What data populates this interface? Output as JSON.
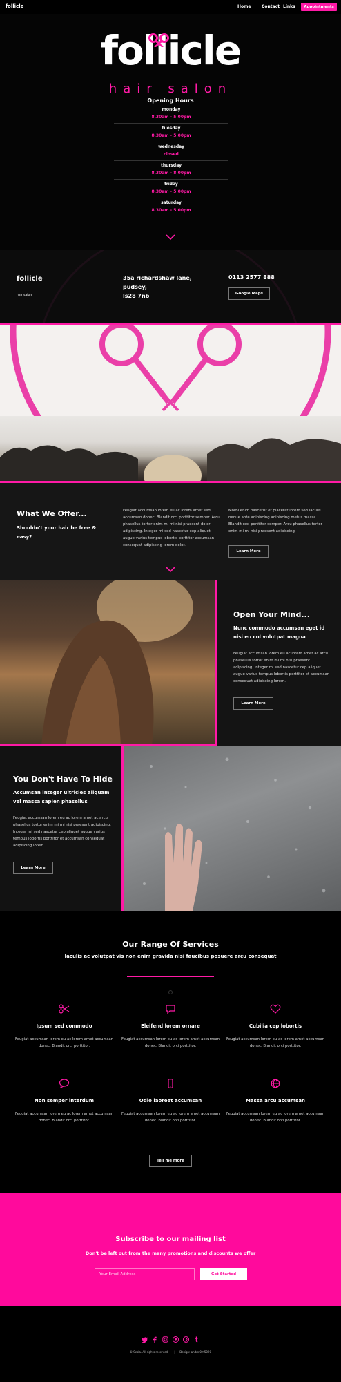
{
  "nav": {
    "brand": "follicle",
    "links": [
      "Home",
      "Contact",
      "Links"
    ],
    "cta": "Appointments"
  },
  "hero": {
    "logo": "follicle",
    "tagline": "hair salon",
    "hours_title": "Opening Hours",
    "days": [
      {
        "day": "monday",
        "time": "8.30am - 5.00pm"
      },
      {
        "day": "tuesday",
        "time": "8.30am - 5.00pm"
      },
      {
        "day": "wednesday",
        "time": "closed"
      },
      {
        "day": "thursday",
        "time": "8.30am - 8.00pm"
      },
      {
        "day": "friday",
        "time": "8.30am - 5.00pm"
      },
      {
        "day": "saturday",
        "time": "8.30am - 5.00pm"
      }
    ]
  },
  "contact": {
    "name": "follicle",
    "sub": "hair salon",
    "address_1": "35a richardshaw lane,",
    "address_2": "pudsey,",
    "address_3": "ls28 7nb",
    "phone": "0113 2577 888",
    "maps_button": "Google Maps"
  },
  "offer": {
    "heading": "What We Offer...",
    "question": "Shouldn't your hair be free & easy?",
    "text_1": "Feugiat accumsan lorem eu ac lorem amet sed accumsan donec. Blandit orci porttitor semper. Arcu phasellus tortor enim mi mi nisi praesent dolor adipiscing. Integer mi sed nascetur cep aliquet augue varius tempus lobortis porttitor accumsan consequat adipiscing lorem dolor.",
    "text_2": "Morbi enim nascetur et placerat lorem sed iaculis neque ante adipiscing adipiscing metus massa. Blandit orci porttitor semper. Arcu phasellus tortor enim mi mi nisi praesent adipiscing.",
    "button": "Learn More"
  },
  "mind": {
    "heading": "Open Your Mind...",
    "sub": "Nunc commodo accumsan eget id nisi eu col volutpat magna",
    "text": "Feugiat accumsan lorem eu ac lorem amet ac arcu phasellus tortor enim mi mi nisi praesent adipiscing. Integer mi sed nascetur cep aliquet augue varius tempus lobortis porttitor et accumsan consequat adipiscing lorem.",
    "button": "Learn More"
  },
  "hide": {
    "heading": "You Don't Have To Hide",
    "sub": "Accumsan integer ultricies aliquam vel massa sapien phasellus",
    "text": "Feugiat accumsan lorem eu ac lorem amet ac arcu phasellus tortor enim mi mi nisi praesent adipiscing. Integer mi sed nascetur cep aliquet augue varius tempus lobortis porttitor et accumsan consequat adipiscing lorem.",
    "button": "Learn More"
  },
  "services": {
    "heading": "Our Range Of Services",
    "sub": "Iaculis ac volutpat vis non enim gravida nisi faucibus posuere arcu consequat",
    "items": [
      {
        "icon": "scissors-icon",
        "title": "Ipsum sed commodo",
        "text": "Feugiat accumsan lorem eu ac lorem amet accumsan donec. Blandit orci porttitor."
      },
      {
        "icon": "chat-icon",
        "title": "Eleifend lorem ornare",
        "text": "Feugiat accumsan lorem eu ac lorem amet accumsan donec. Blandit orci porttitor."
      },
      {
        "icon": "heart-icon",
        "title": "Cubilia cep lobortis",
        "text": "Feugiat accumsan lorem eu ac lorem amet accumsan donec. Blandit orci porttitor."
      },
      {
        "icon": "comment-icon",
        "title": "Non semper interdum",
        "text": "Feugiat accumsan lorem eu ac lorem amet accumsan donec. Blandit orci porttitor."
      },
      {
        "icon": "mobile-icon",
        "title": "Odio laoreet accumsan",
        "text": "Feugiat accumsan lorem eu ac lorem amet accumsan donec. Blandit orci porttitor."
      },
      {
        "icon": "globe-icon",
        "title": "Massa arcu accumsan",
        "text": "Feugiat accumsan lorem eu ac lorem amet accumsan donec. Blandit orci porttitor."
      }
    ],
    "button": "Tell me more"
  },
  "subscribe": {
    "heading": "Subscribe to our mailing list",
    "sub": "Don't be left out from the many promotions and discounts we offer",
    "placeholder": "Your Email Address",
    "button": "Get Started"
  },
  "footer": {
    "socials": [
      "twitter-icon",
      "facebook-icon",
      "instagram-icon",
      "github-icon",
      "pinterest-icon",
      "tumblr-icon"
    ],
    "copyright": "© Scala. All rights reserved.",
    "design": "Design: andm.0m5090"
  },
  "colors": {
    "accent": "#ff1aa6",
    "background": "#000000",
    "subscribe_bg": "#ff0a9c"
  }
}
